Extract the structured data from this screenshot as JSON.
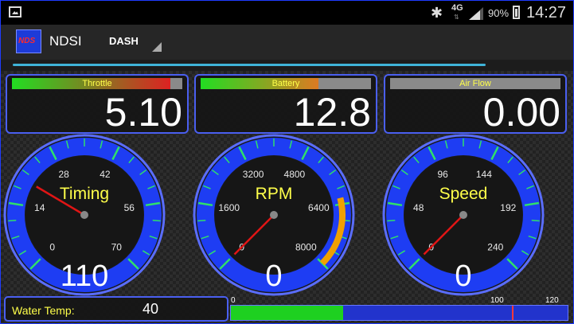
{
  "status_bar": {
    "network": "4G",
    "battery_percent": "90%",
    "time": "14:27"
  },
  "action_bar": {
    "app_title": "NDSI",
    "logo_text": "NDS",
    "spinner_selected": "DASH"
  },
  "colors": {
    "gauge_blue": "#1f3fff",
    "needle_red": "#e01515",
    "label_yellow": "#ffff4a",
    "tick_green": "#2fe06a",
    "value_white": "#ffffff",
    "warning_orange": "#f0a000"
  },
  "readouts": [
    {
      "label": "Throttle",
      "value": "5.10",
      "fill_fraction": 0.93,
      "fill_gradient": [
        "#22dd22",
        "#dd2222"
      ]
    },
    {
      "label": "Battery",
      "value": "12.8",
      "fill_fraction": 0.69,
      "fill_gradient": [
        "#22dd22",
        "#dd7a22"
      ]
    },
    {
      "label": "Air Flow",
      "value": "0.00",
      "fill_fraction": 0.0,
      "fill_gradient": [
        "#22dd22",
        "#dd2222"
      ]
    }
  ],
  "gauges": [
    {
      "name": "Timing",
      "value": "110",
      "ticks": [
        "0",
        "14",
        "28",
        "42",
        "56",
        "70"
      ],
      "needle_fraction": 0.28,
      "warning_band": null
    },
    {
      "name": "RPM",
      "value": "0",
      "ticks": [
        "0",
        "1600",
        "3200",
        "4800",
        "6400",
        "8000"
      ],
      "needle_fraction": 0.0,
      "warning_band": [
        0.78,
        1.0
      ]
    },
    {
      "name": "Speed",
      "value": "0",
      "ticks": [
        "0",
        "48",
        "96",
        "144",
        "192",
        "240"
      ],
      "needle_fraction": 0.0,
      "warning_band": null
    }
  ],
  "water_temp": {
    "label": "Water Temp:",
    "value": "40",
    "scale_labels": [
      "0",
      "100",
      "120"
    ],
    "scale_max": 120,
    "fill_value": 40,
    "marker_value": 100
  }
}
